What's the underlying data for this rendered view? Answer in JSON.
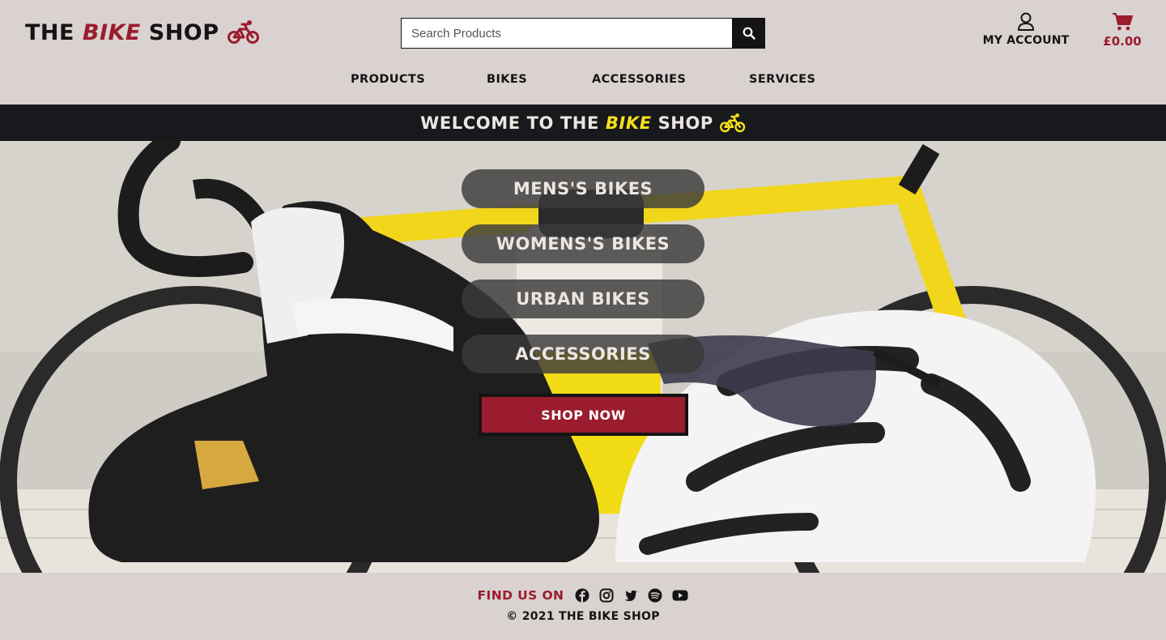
{
  "brand": {
    "part1": "THE ",
    "accent": "BIKE",
    "part2": " SHOP",
    "icon": "bicycle-icon",
    "accent_color": "#9b1c2e"
  },
  "search": {
    "placeholder": "Search Products",
    "value": "",
    "button_icon": "search-icon"
  },
  "account": {
    "label": "MY ACCOUNT",
    "icon": "user-icon"
  },
  "cart": {
    "total": "£0.00",
    "icon": "shopping-cart-icon",
    "color": "#9b1c2e"
  },
  "nav": {
    "items": [
      {
        "label": "PRODUCTS"
      },
      {
        "label": "BIKES"
      },
      {
        "label": "ACCESSORIES"
      },
      {
        "label": "SERVICES"
      }
    ]
  },
  "banner": {
    "part1": "WELCOME TO THE ",
    "accent": "BIKE",
    "part2": " SHOP",
    "icon": "bicycle-icon",
    "accent_color": "#f5e11a",
    "background": "#18191c"
  },
  "hero": {
    "categories": [
      {
        "label": "MENS'S BIKES"
      },
      {
        "label": "WOMENS'S BIKES"
      },
      {
        "label": "URBAN BIKES"
      },
      {
        "label": "ACCESSORIES"
      }
    ],
    "cta": "SHOP NOW",
    "cta_color": "#9b1c2e"
  },
  "footer": {
    "find_us_label": "FIND US ON",
    "social_icons": [
      "facebook-icon",
      "instagram-icon",
      "twitter-icon",
      "spotify-icon",
      "youtube-icon"
    ],
    "copyright": "© 2021 THE BIKE SHOP"
  }
}
